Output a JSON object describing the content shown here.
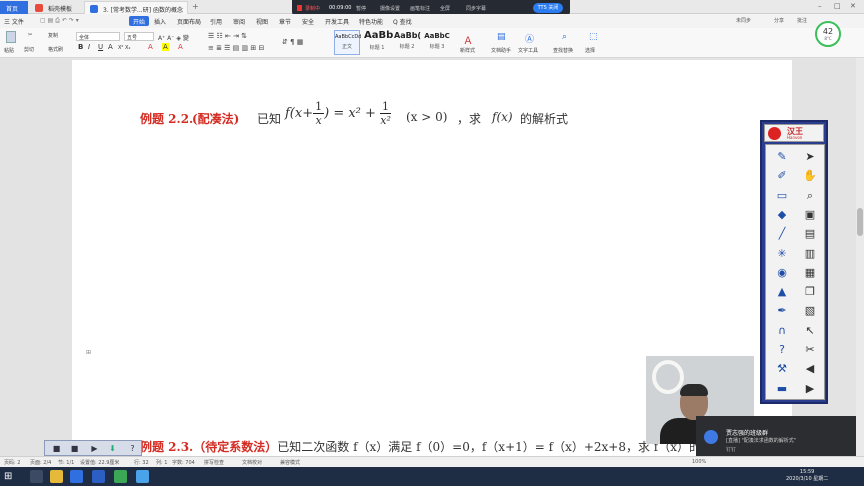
{
  "tabs": {
    "home": "首页",
    "template": "稻壳模板",
    "doc": "3. [常考数学...研] 函数的概念",
    "add": "+"
  },
  "recorder": {
    "recording": "录制中",
    "time": "00:09:00",
    "pause": "暂停",
    "camera": "摄像设置",
    "annotate": "画笔标注",
    "screen": "全屏",
    "language": "同步字幕",
    "finish": "TTS 关闭"
  },
  "menu": {
    "file": "三 文件",
    "start": "开始",
    "insert": "插入",
    "layout": "页面布局",
    "reference": "引用",
    "review": "审阅",
    "view": "视图",
    "chapter": "章节",
    "security": "安全",
    "dev": "开发工具",
    "special": "特色功能",
    "search": "Q 查找",
    "sync": "未同步",
    "share": "分享",
    "comment": "批注"
  },
  "ribbon": {
    "paste": "粘贴",
    "cut": "剪切",
    "copy": "复制",
    "format_painter": "格式刷",
    "font_name": "全体",
    "font_size": "五号",
    "styles": [
      {
        "sample": "AaBbCcDd",
        "name": "正文"
      },
      {
        "sample": "AaBb",
        "name": "标题 1"
      },
      {
        "sample": "AaBb(",
        "name": "标题 2"
      },
      {
        "sample": "AaBbC",
        "name": "标题 3"
      }
    ],
    "new_style": "新样式",
    "assistant": "文档助手",
    "text_tools": "文字工具",
    "find_replace": "查找替换",
    "select": "选择"
  },
  "document": {
    "ex22_label": "例题 2.2.",
    "ex22_method": "(配凑法)",
    "ex22_given": "已知",
    "ex22_cond": "(x > 0)",
    "ex22_ask": "，求",
    "ex22_target": "的解析式",
    "ex23_label": "例题 2.3.",
    "ex23_method": "（待定系数法）",
    "ex23_text": "已知二次函数 f（x）满足 f（0）=0，f（x+1）= f（x）+2x+8，求 f（x）的"
  },
  "hanwang": {
    "name": "汉王",
    "sub": "Hanvon",
    "tools": [
      "pen-icon",
      "pointer-icon",
      "highlighter-icon",
      "hand-icon",
      "eraser-icon",
      "magnifier-icon",
      "fill-icon",
      "save-icon",
      "line-icon",
      "page-icon",
      "spotlight-icon",
      "page2-icon",
      "camera-icon",
      "page3-icon",
      "shapes-icon",
      "copy-icon",
      "marker-icon",
      "clipboard-icon",
      "magnet-icon",
      "cursor-icon",
      "help-icon",
      "cut-icon",
      "tools-icon",
      "back-icon",
      "screen-icon",
      "forward-icon"
    ]
  },
  "notification": {
    "title": "贾志强的班级群",
    "message": "[直播] \"配凑法求函数的解析式\"",
    "app": "钉钉"
  },
  "status": {
    "page_num": "页码: 2",
    "pages": "页面: 2/4",
    "section": "节: 1/1",
    "position": "设置值: 22.9厘米",
    "row": "行: 32",
    "col": "列: 1",
    "words": "字数: 704",
    "spell": "拼写检查",
    "proof": "文档校对",
    "compat": "兼容模式",
    "zoom": "100%"
  },
  "clock": {
    "time": "15:59",
    "date": "2020/3/10 星期二"
  },
  "badge": {
    "value": "42",
    "temp": "8°C"
  },
  "colors": {
    "accent": "#2f6fdf",
    "example_red": "#d42c23"
  }
}
